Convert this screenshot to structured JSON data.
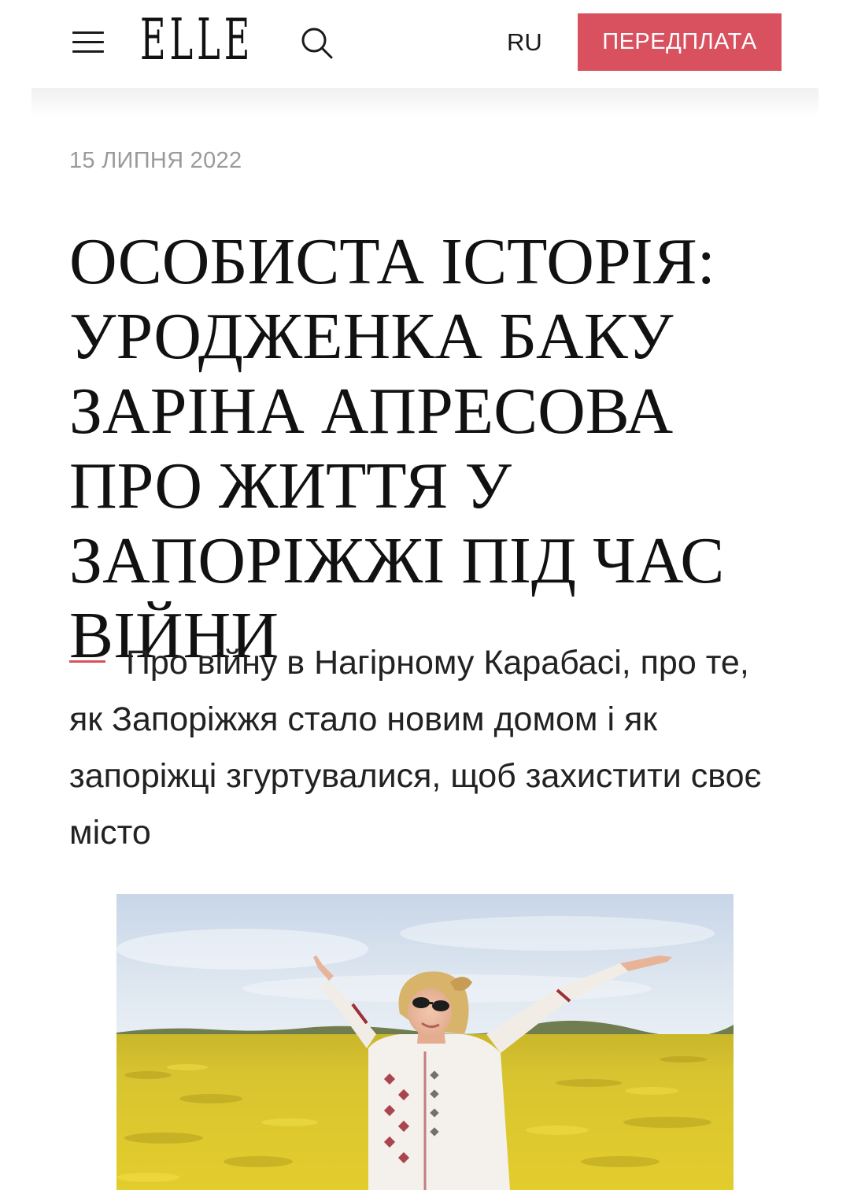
{
  "header": {
    "logo": "ELLE",
    "lang": "RU",
    "subscribe_label": "ПЕРЕДПЛАТА",
    "menu_icon": "hamburger-menu-icon",
    "search_icon": "search-icon",
    "accent_color": "#d9505f"
  },
  "article": {
    "date": "15 ЛИПНЯ 2022",
    "headline": "ОСОБИСТА ІСТОРІЯ: УРОДЖЕНКА БАКУ ЗАРІНА АПРЕСОВА ПРО ЖИТТЯ У ЗАПОРІЖЖІ ПІД ЧАС ВІЙНИ",
    "lead": "Про війну в Нагірному Карабасі, про те, як Запоріжжя стало новим домом і як запоріжці згуртувалися, щоб захистити своє місто"
  }
}
